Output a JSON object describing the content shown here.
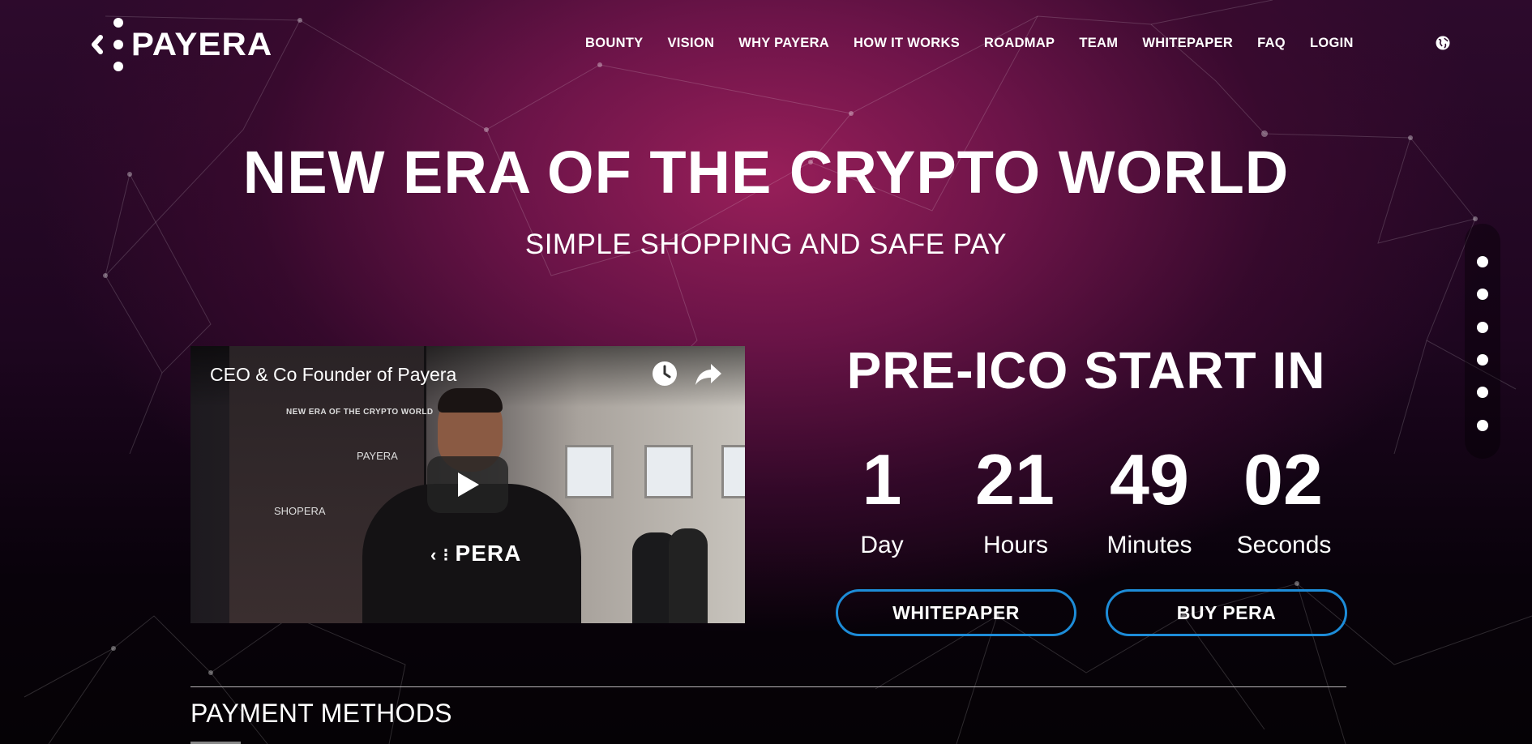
{
  "brand": {
    "logo_text": "PAYERA"
  },
  "nav": {
    "items": [
      {
        "label": "BOUNTY"
      },
      {
        "label": "VISION"
      },
      {
        "label": "WHY PAYERA"
      },
      {
        "label": "HOW IT WORKS"
      },
      {
        "label": "ROADMAP"
      },
      {
        "label": "TEAM"
      },
      {
        "label": "WHITEPAPER"
      },
      {
        "label": "FAQ"
      },
      {
        "label": "LOGIN"
      }
    ],
    "language_icon": "globe-icon"
  },
  "hero": {
    "title": "NEW ERA OF THE CRYPTO WORLD",
    "subtitle": "SIMPLE SHOPPING AND SAFE PAY"
  },
  "video": {
    "title": "CEO & Co Founder of Payera",
    "poster_heading": "NEW ERA OF THE CRYPTO WORLD",
    "poster_labels": [
      "PAYERA",
      "SHOPERA"
    ],
    "shirt_text": "PERA",
    "watch_later_icon": "clock-icon",
    "share_icon": "share-icon",
    "play_icon": "play-icon"
  },
  "countdown": {
    "heading": "PRE-ICO START IN",
    "units": [
      {
        "value": "1",
        "label": "Day"
      },
      {
        "value": "21",
        "label": "Hours"
      },
      {
        "value": "49",
        "label": "Minutes"
      },
      {
        "value": "02",
        "label": "Seconds"
      }
    ]
  },
  "buttons": {
    "whitepaper": "WHITEPAPER",
    "buy": "BUY PERA"
  },
  "section_dots": {
    "count": 6,
    "active_index": 0
  },
  "payment": {
    "title": "PAYMENT METHODS"
  },
  "colors": {
    "accent_button_border": "#1d8cd8",
    "hero_glow": "#9e205c",
    "background_dark": "#08020a"
  }
}
